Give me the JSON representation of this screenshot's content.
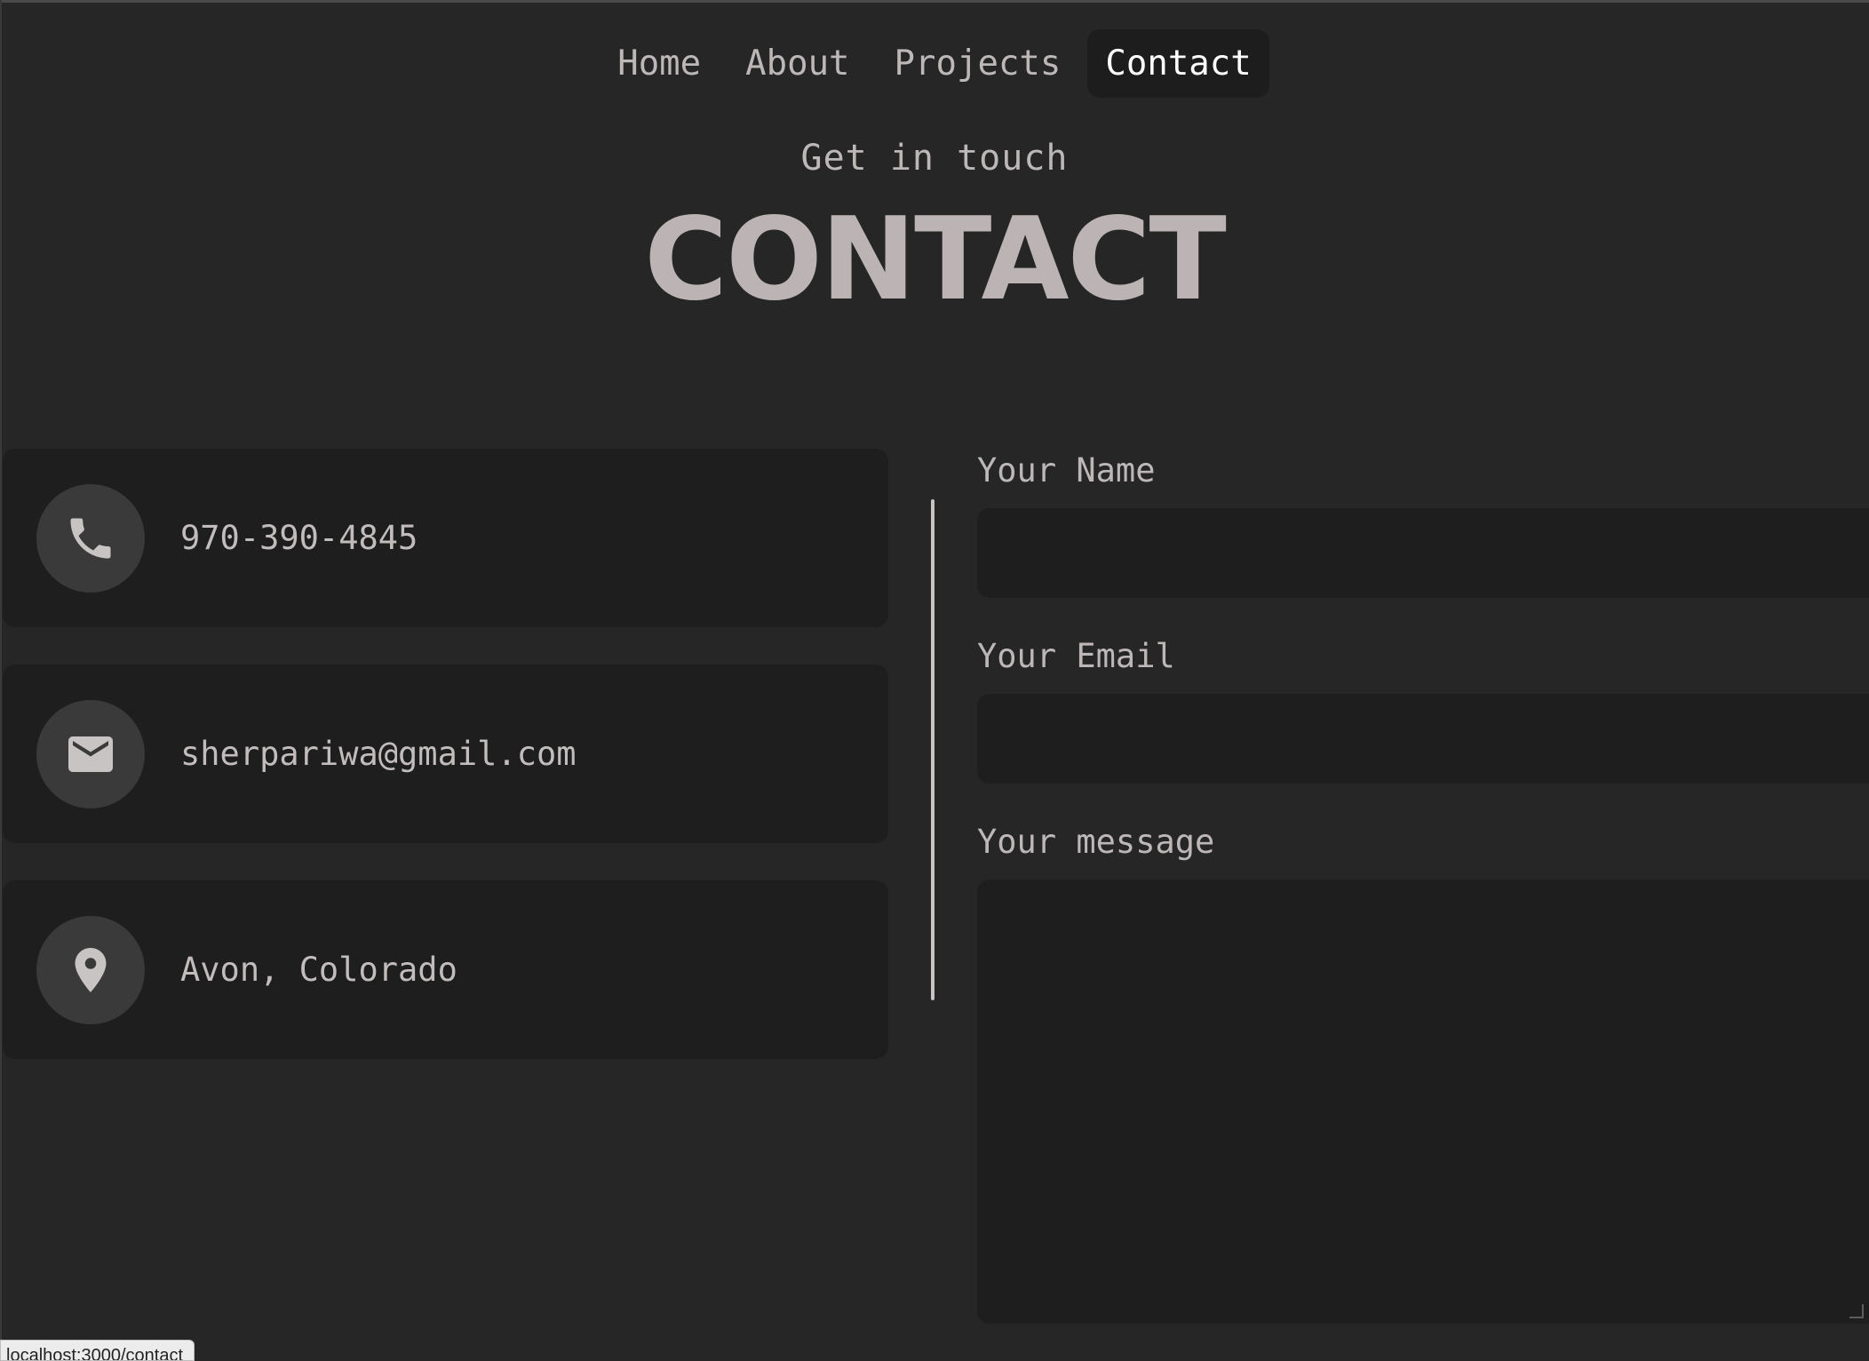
{
  "nav": {
    "items": [
      {
        "label": "Home"
      },
      {
        "label": "About"
      },
      {
        "label": "Projects"
      },
      {
        "label": "Contact",
        "active": true
      }
    ]
  },
  "header": {
    "eyebrow": "Get in touch",
    "title": "CONTACT"
  },
  "contact_cards": [
    {
      "icon": "phone-icon",
      "text": "970-390-4845"
    },
    {
      "icon": "mail-icon",
      "text": "sherpariwa@gmail.com"
    },
    {
      "icon": "location-pin-icon",
      "text": "Avon, Colorado"
    }
  ],
  "form": {
    "name_label": "Your Name",
    "name_value": "",
    "email_label": "Your Email",
    "email_value": "",
    "message_label": "Your message",
    "message_value": ""
  },
  "status_bar": {
    "url": "localhost:3000/contact"
  },
  "colors": {
    "background": "#262626",
    "card": "#1e1e1e",
    "icon_circle": "#3a3a3a",
    "text": "#bdb7b7",
    "active_nav_text": "#ffffff"
  }
}
